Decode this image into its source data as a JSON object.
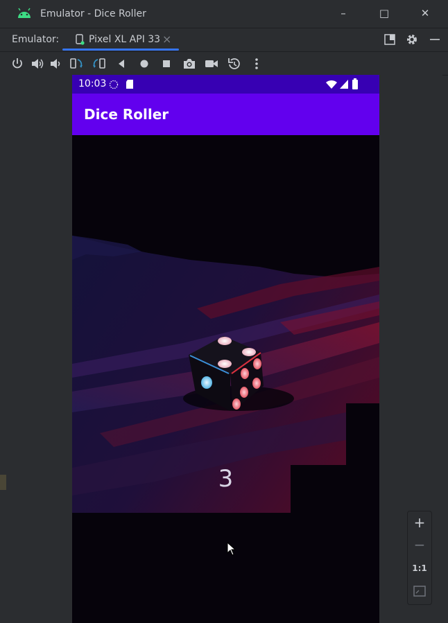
{
  "window": {
    "title": "Emulator - Dice Roller",
    "controls": {
      "minimize": "–",
      "maximize": "□",
      "close": "✕"
    }
  },
  "tabbar": {
    "label": "Emulator:",
    "active_tab": "Pixel XL API 33",
    "close_glyph": "×"
  },
  "toolbar": {
    "icons": [
      "power-icon",
      "volume-up-icon",
      "volume-down-icon",
      "rotate-left-icon",
      "rotate-right-icon",
      "back-icon",
      "home-icon",
      "overview-icon",
      "screenshot-icon",
      "screen-record-icon",
      "reset-icon",
      "more-options-icon"
    ]
  },
  "device": {
    "status_time": "10:03",
    "app_title": "Dice Roller",
    "roll_result": "3",
    "colors": {
      "status_bar": "#3700b3",
      "app_bar": "#6200ee",
      "background": "#06030b"
    }
  },
  "zoom": {
    "zoom_in": "+",
    "zoom_out": "−",
    "actual_size": "1:1"
  }
}
